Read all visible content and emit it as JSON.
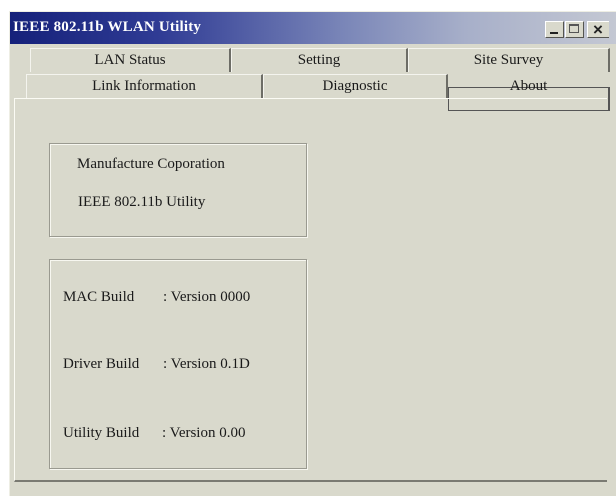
{
  "window": {
    "title": "IEEE 802.11b WLAN Utility"
  },
  "tabs": {
    "row1": [
      "LAN Status",
      "Setting",
      "Site Survey"
    ],
    "row2": [
      "Link Information",
      "Diagnostic",
      "About"
    ],
    "active": "About"
  },
  "about": {
    "company": "Manufacture Coporation",
    "product": "IEEE 802.11b Utility",
    "mac_build_label": "MAC Build",
    "mac_build_value": ": Version 0000",
    "driver_build_label": "Driver Build",
    "driver_build_value": ": Version 0.1D",
    "utility_build_label": "Utility Build",
    "utility_build_value": ": Version 0.00"
  },
  "colors": {
    "titlebar_start": "#15217a",
    "titlebar_end": "#c4c8d3",
    "face": "#d9d9cc"
  }
}
